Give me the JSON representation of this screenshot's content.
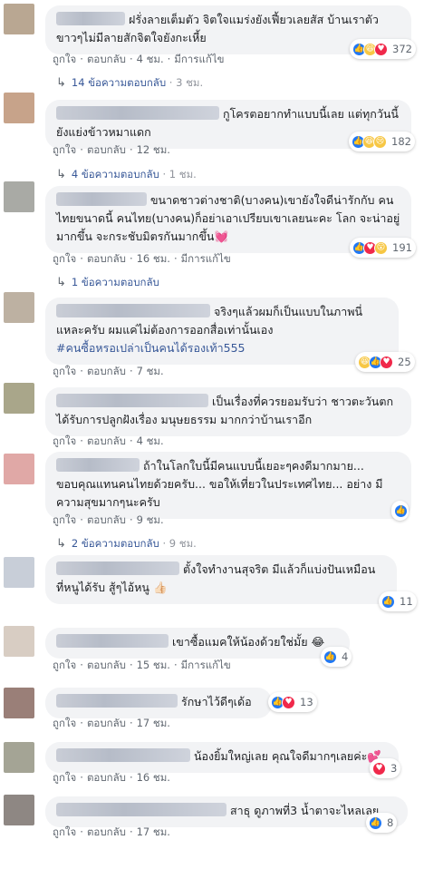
{
  "ui": {
    "like": "ถูกใจ",
    "reply": "ตอบกลับ",
    "edited": "มีการแก้ไข",
    "dot": "·"
  },
  "comments": [
    {
      "text": "ฝรั่งลายเต็มตัว จิตใจแมร่งยังเฟี้ยวเลยสัส บ้านเราตัว ขาวๆไม่มีลายสักจิตใจยังกะเหี้ย",
      "time": "4 ชม.",
      "edited": true,
      "reactions": [
        "like",
        "haha",
        "love"
      ],
      "count": "372",
      "replies": "14 ข้อความตอบกลับ",
      "replies_time": "3 ชม.",
      "avatar_color": "#b9a792"
    },
    {
      "text": "กูโครตอยากทำแบบนี้เลย แต่ทุกวันนี้ ยังแย่งข้าวหมาแดก",
      "time": "12 ชม.",
      "edited": false,
      "reactions": [
        "like",
        "haha",
        "sad"
      ],
      "count": "182",
      "replies": "4 ข้อความตอบกลับ",
      "replies_time": "1 ชม.",
      "avatar_color": "#c7a38a"
    },
    {
      "text": "ขนาดชาวต่างชาติ(บางคน)เขายังใจดีน่ารักกับ คนไทยขนาดนี้ คนไทย(บางคน)ก็อย่าเอาเปรียบเขาเลยนะคะ โลก จะน่าอยู่มากขึ้น จะกระชับมิตรกันมากขึ้น💓",
      "time": "16 ชม.",
      "edited": true,
      "reactions": [
        "like",
        "love",
        "wow"
      ],
      "count": "191",
      "replies": "1 ข้อความตอบกลับ",
      "replies_time": "",
      "avatar_color": "#a9aaa5"
    },
    {
      "text": "จริงๆแล้วผมก็เป็นแบบในภาพนี่ แหละครับ ผมแค่ไม่ต้องการออกสื่อเท่านั้นเอง",
      "hashtag": "#คนซื้อหรอเปล่าเป็นคนได้รองเท้า555",
      "time": "7 ชม.",
      "edited": false,
      "reactions": [
        "haha",
        "like",
        "love"
      ],
      "count": "25",
      "avatar_color": "#bdb1a2"
    },
    {
      "text": "เป็นเรื่องที่ควรยอมรับว่า ชาวตะวันตก ได้รับการปลูกฝังเรื่อง มนุษยธรรม มากกว่าบ้านเราอีก",
      "time": "4 ชม.",
      "edited": false,
      "avatar_color": "#a9a68a"
    },
    {
      "text": "ถ้าในโลกใบนี้มีคนแบบนี้เยอะๆคงดีมากมาย... ขอบคุณแทนคนไทยด้วยครับ... ขอให้เที่ยวในประเทศไทย... อย่าง มีความสุขมากๆนะครับ",
      "time": "9 ชม.",
      "edited": false,
      "reactions": [
        "like"
      ],
      "count": "",
      "replies": "2 ข้อความตอบกลับ",
      "replies_time": "9 ชม.",
      "avatar_color": "#e0a8a6"
    },
    {
      "text": "ตั้งใจทำงานสุจริต มีแล้วก็แบ่งปันเหมือน ที่หนูได้รับ สู้ๆไอ้หนู 👍🏻",
      "time": "",
      "edited": false,
      "reactions": [
        "like"
      ],
      "count": "11",
      "avatar_color": "#c8ced8"
    },
    {
      "text": "เขาซื้อแมคให้น้องด้วยใช่มั้ย 😂",
      "time": "15 ชม.",
      "edited": true,
      "reactions": [
        "like"
      ],
      "count": "4",
      "avatar_color": "#d8cdc3"
    },
    {
      "text": "รักษาไว้ดีๆเด้อ",
      "time": "17 ชม.",
      "edited": false,
      "reactions": [
        "like",
        "love"
      ],
      "count": "13",
      "avatar_color": "#9a7f78"
    },
    {
      "text": "น้องยิ้มใหญ่เลย คุณใจดีมากๆเลยค่ะ💕",
      "time": "16 ชม.",
      "edited": false,
      "reactions": [
        "love"
      ],
      "count": "3",
      "avatar_color": "#a4a495"
    },
    {
      "text": "สาธุ ดูภาพที่3 น้ำตาจะไหลเลย",
      "time": "17 ชม.",
      "edited": false,
      "reactions": [
        "like"
      ],
      "count": "8",
      "avatar_color": "#8e8783"
    }
  ]
}
